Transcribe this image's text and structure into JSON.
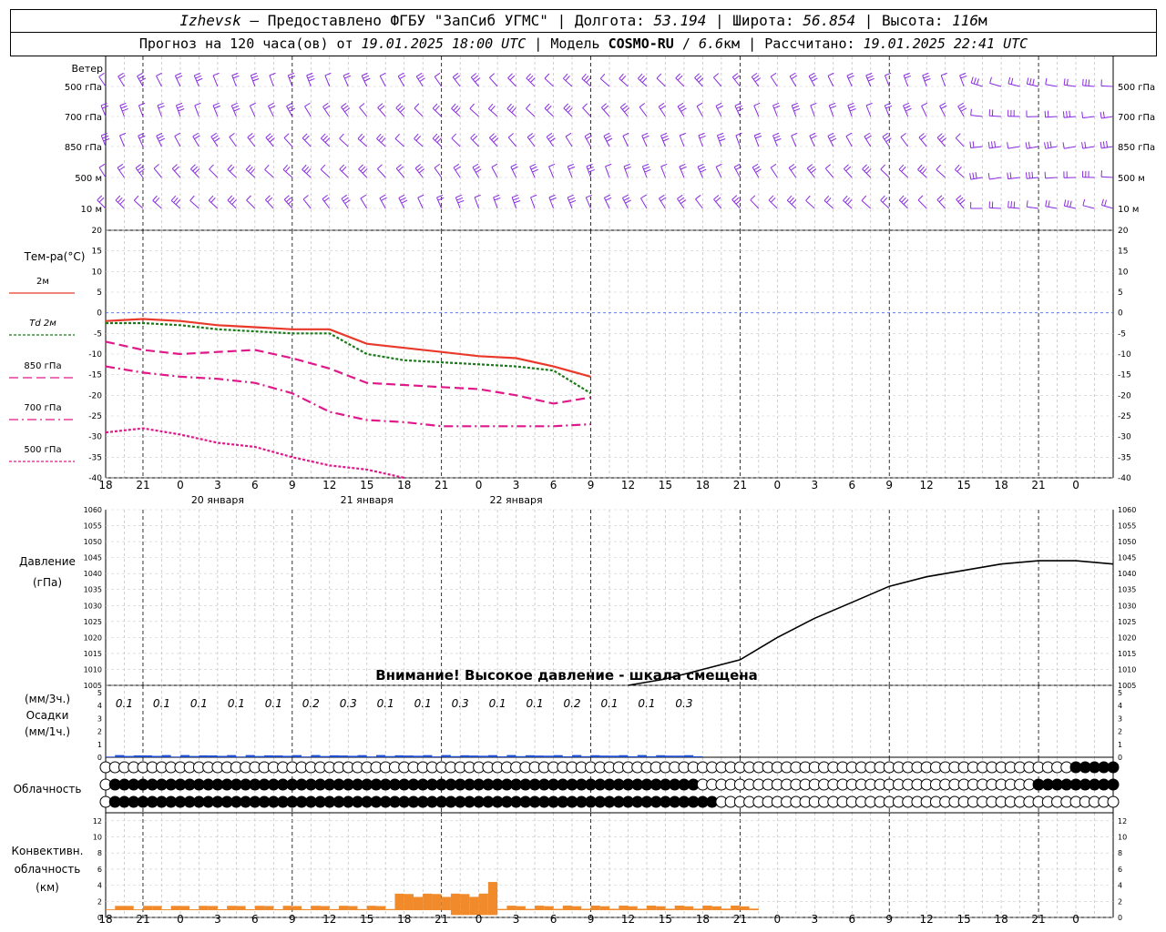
{
  "header": {
    "city": "Izhevsk",
    "provider_text": "— Предоставлено ФГБУ \"ЗапСиб УГМС\"",
    "lon_label": "Долгота:",
    "lon": "53.194",
    "lat_label": "Широта:",
    "lat": "56.854",
    "alt_label": "Высота:",
    "alt": "116",
    "alt_unit": "м",
    "forecast_label": "Прогноз на 120 часа(ов) от",
    "forecast_time": "19.01.2025 18:00 UTC",
    "model_label": "Модель",
    "model": "COSMO-RU",
    "resolution": "6.6",
    "res_unit": "км",
    "calc_label": "Рассчитано:",
    "calc_time": "19.01.2025 22:41 UTC"
  },
  "wind_panel": {
    "title": "Ветер",
    "levels": [
      "500 гПа",
      "700 гПа",
      "850 гПа",
      "500 м",
      "10  м"
    ],
    "color": "#8a2be2"
  },
  "temp_panel": {
    "title": "Тем-ра(°С)",
    "legend": [
      {
        "label": "2м",
        "color": "#e8392a",
        "style": "solid"
      },
      {
        "label": "Td  2м",
        "color": "#1a7a1a",
        "style": "dotted"
      },
      {
        "label": "850 гПа",
        "color": "#e0198a",
        "style": "dashed"
      },
      {
        "label": "700 гПа",
        "color": "#e0198a",
        "style": "dashdot"
      },
      {
        "label": "500 гПа",
        "color": "#e0198a",
        "style": "dotted"
      }
    ],
    "yticks": [
      20,
      15,
      10,
      5,
      0,
      -5,
      -10,
      -15,
      -20,
      -25,
      -30,
      -35,
      -40
    ]
  },
  "pressure_panel": {
    "title": "Давление",
    "unit": "(гПа)",
    "yticks": [
      1060,
      1055,
      1050,
      1045,
      1040,
      1035,
      1030,
      1025,
      1020,
      1015,
      1010,
      1005
    ],
    "warning": "Внимание! Высокое давление - шкала смещена"
  },
  "precip_panel": {
    "unit3h": "(мм/3ч.)",
    "title": "Осадки",
    "unit1h": "(мм/1ч.)",
    "totals": [
      "0.1",
      "0.1",
      "0.1",
      "0.1",
      "0.1",
      "0.2",
      "0.3",
      "0.1",
      "0.1",
      "0.3",
      "0.1",
      "0.1",
      "0.2",
      "0.1",
      "0.1",
      "0.3"
    ],
    "yticks": [
      5,
      4,
      3,
      2,
      1,
      0
    ],
    "color": "#1f4fd1"
  },
  "cloud_panel": {
    "title": "Облачность"
  },
  "conv_panel": {
    "title1": "Конвективн.",
    "title2": "облачность",
    "unit": "(км)",
    "yticks": [
      12,
      10,
      8,
      6,
      4,
      2,
      0
    ],
    "color": "#f08a2a"
  },
  "time_axis": {
    "hour_labels": [
      "18",
      "21",
      "0",
      "3",
      "6",
      "9",
      "12",
      "15",
      "18",
      "21",
      "0",
      "3",
      "6",
      "9",
      "12",
      "15",
      "18",
      "21",
      "0",
      "3",
      "6",
      "9",
      "12",
      "15",
      "18",
      "21",
      "0"
    ],
    "day_labels": [
      "20 января",
      "21 января",
      "22 января"
    ]
  },
  "chart_data": {
    "type": "line",
    "x_hours": [
      0,
      6,
      12,
      18,
      24,
      30,
      36,
      42,
      48,
      54,
      60,
      66,
      72,
      78
    ],
    "series": [
      {
        "name": "2м",
        "values": [
          -2,
          -1.5,
          -2,
          -3,
          -3.5,
          -4,
          -4,
          -7.5,
          -8.5,
          -9.5,
          -10.5,
          -11,
          -13,
          -15.5
        ]
      },
      {
        "name": "Td  2м",
        "values": [
          -2.5,
          -2.5,
          -3,
          -4,
          -4.5,
          -5,
          -5,
          -10,
          -11.5,
          -12,
          -12.5,
          -13,
          -14,
          -19.5
        ]
      },
      {
        "name": "850 гПа",
        "values": [
          -7,
          -9,
          -10,
          -9.5,
          -9,
          -11,
          -13.5,
          -17,
          -17.5,
          -18,
          -18.5,
          -20,
          -22,
          -20.5
        ]
      },
      {
        "name": "700 гПа",
        "values": [
          -13,
          -14.5,
          -15.5,
          -16,
          -17,
          -19.5,
          -24,
          -26,
          -26.5,
          -27.5,
          -27.5,
          -27.5,
          -27.5,
          -27
        ]
      },
      {
        "name": "500 гПа",
        "values": [
          -29,
          -28,
          -29.5,
          -31.5,
          -32.5,
          -35,
          -37,
          -38,
          -40,
          null,
          null,
          null,
          null,
          null
        ]
      }
    ],
    "pressure_hpa": [
      {
        "h": 84,
        "v": 1005
      },
      {
        "h": 90,
        "v": 1007
      },
      {
        "h": 96,
        "v": 1010
      },
      {
        "h": 102,
        "v": 1013
      },
      {
        "h": 108,
        "v": 1020
      },
      {
        "h": 114,
        "v": 1026
      },
      {
        "h": 120,
        "v": 1031
      },
      {
        "h": 126,
        "v": 1036
      },
      {
        "h": 132,
        "v": 1039
      },
      {
        "h": 138,
        "v": 1041
      },
      {
        "h": 144,
        "v": 1043
      },
      {
        "h": 150,
        "v": 1044
      },
      {
        "h": 156,
        "v": 1044
      },
      {
        "h": 162,
        "v": 1043
      }
    ],
    "xlabel": "",
    "ylabel": "Тем-ра(°С)",
    "ylim": [
      -40,
      20
    ],
    "grid": true
  }
}
